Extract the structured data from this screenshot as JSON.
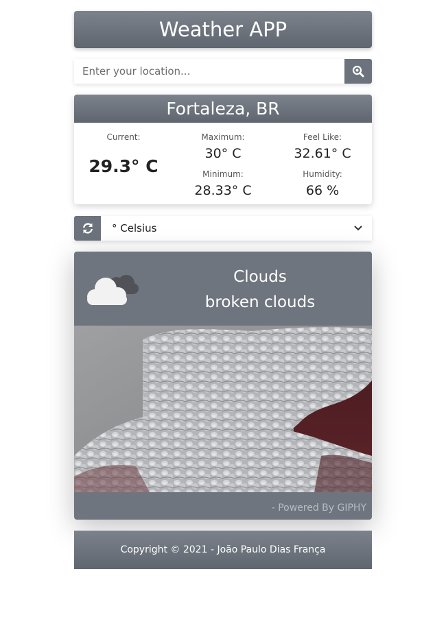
{
  "app": {
    "title": "Weather APP"
  },
  "search": {
    "placeholder": "Enter your location...",
    "value": ""
  },
  "location": {
    "name": "Fortaleza, BR"
  },
  "stats": {
    "current_label": "Current:",
    "current_value": "29.3° C",
    "max_label": "Maximum:",
    "max_value": "30° C",
    "min_label": "Minimum:",
    "min_value": "28.33° C",
    "feels_label": "Feel Like:",
    "feels_value": "32.61° C",
    "humidity_label": "Humidity:",
    "humidity_value": "66 %"
  },
  "units": {
    "selected": "° Celsius"
  },
  "weather": {
    "main": "Clouds",
    "description": "broken clouds",
    "icon": "cloud-icon",
    "powered_by": "- Powered By GIPHY"
  },
  "footer": {
    "text": "Copyright © 2021 - João Paulo Dias França"
  },
  "colors": {
    "accent": "#6c737c",
    "card_bg": "#6f757e",
    "text_light": "#ffffff"
  }
}
